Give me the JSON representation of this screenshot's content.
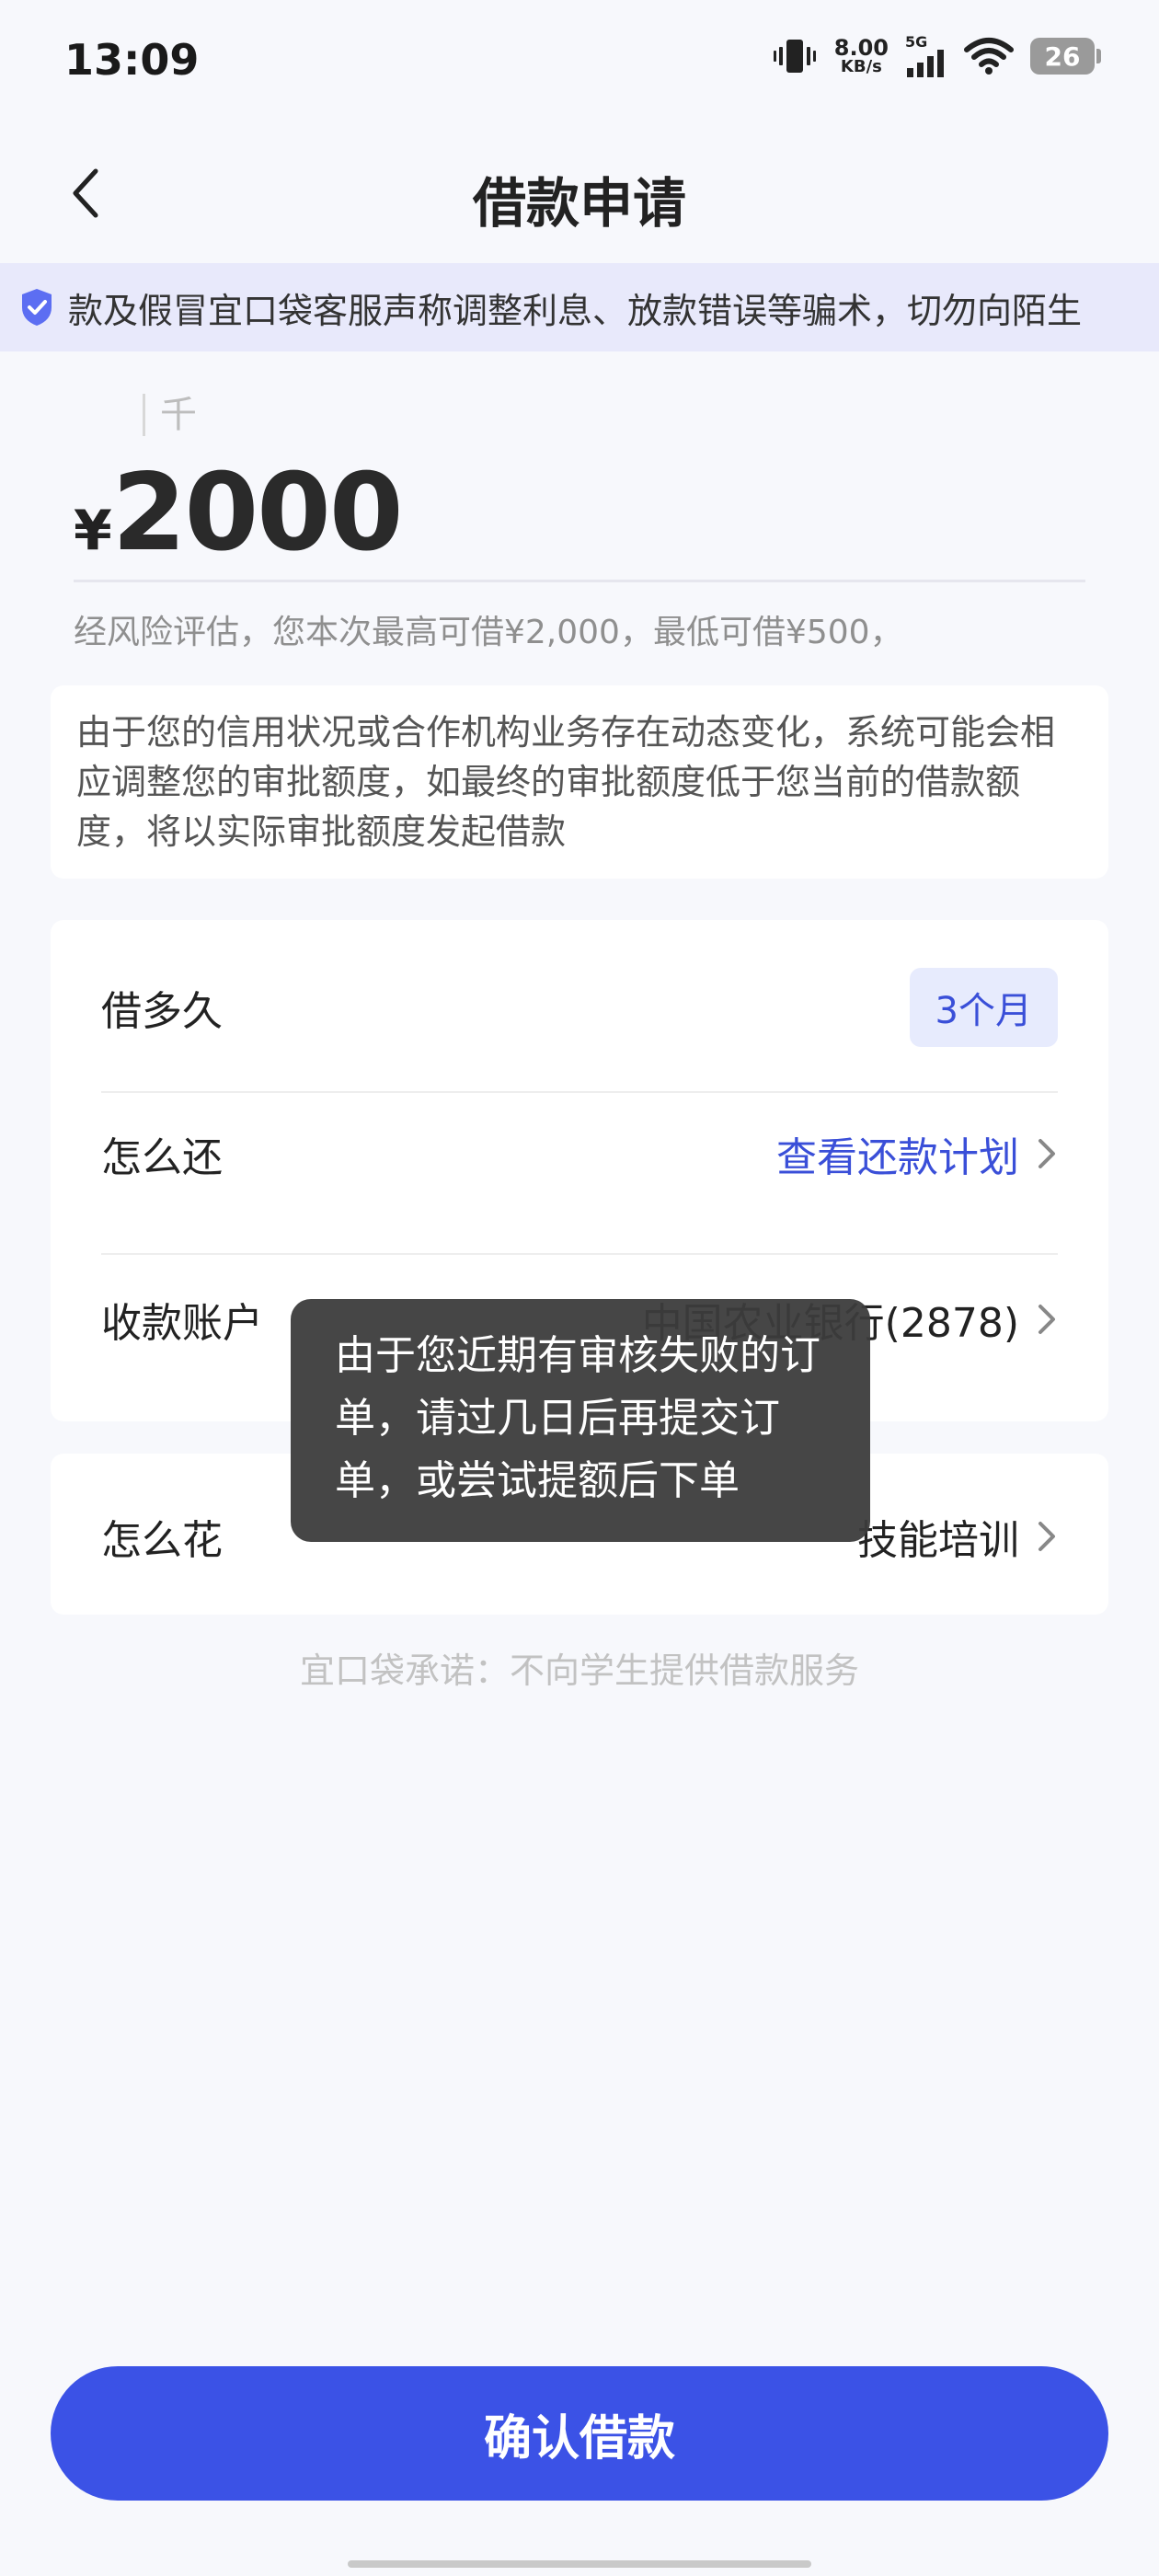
{
  "status_bar": {
    "time": "13:09",
    "net_speed_value": "8.00",
    "net_speed_unit": "KB/s",
    "network_type": "5G",
    "battery": "26"
  },
  "header": {
    "title": "借款申请"
  },
  "notice_banner": {
    "text": "款及假冒宜口袋客服声称调整利息、放款错误等骗术，切勿向陌生"
  },
  "amount": {
    "unit_hint": "千",
    "currency": "¥",
    "value": "2000",
    "limit_note": "经风险评估，您本次最高可借¥2,000，最低可借¥500，"
  },
  "credit_notice": {
    "text": "由于您的信用状况或合作机构业务存在动态变化，系统可能会相应调整您的审批额度，如最终的审批额度低于您当前的借款额度，将以实际审批额度发起借款"
  },
  "options": {
    "term_label": "借多久",
    "term_value": "3个月",
    "repay_label": "怎么还",
    "repay_link": "查看还款计划",
    "account_label": "收款账户",
    "account_value": "中国农业银行(2878)",
    "purpose_label": "怎么花",
    "purpose_value": "技能培训"
  },
  "promise": "宜口袋承诺：不向学生提供借款服务",
  "toast": {
    "text": "由于您近期有审核失败的订单，请过几日后再提交订单，或尝试提额后下单"
  },
  "confirm_button": "确认借款",
  "colors": {
    "primary": "#3b52e6",
    "banner_bg": "#e8e9fb",
    "page_bg": "#f7f8fc"
  }
}
